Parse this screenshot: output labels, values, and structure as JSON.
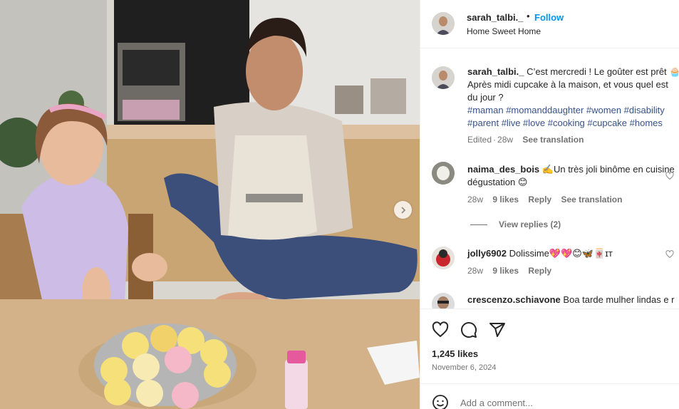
{
  "post": {
    "username": "sarah_talbi._",
    "separator": "•",
    "follow_label": "Follow",
    "location": "Home Sweet Home"
  },
  "caption": {
    "username": "sarah_talbi._",
    "line1": "C’est mercredi ! Le goûter est prêt 🧁",
    "line2": "Après midi cupcake à la maison, et vous quel est",
    "line3": "du jour ?",
    "tags_line1": "#maman #momanddaughter #women #disability",
    "tags_line2": "#parent #live #love #cooking #cupcake #homes",
    "edited": "Edited",
    "age": "28w",
    "see_translation": "See translation"
  },
  "comments": [
    {
      "username": "naima_des_bois",
      "text_line1": "✍️Un très joli binôme en cuisine",
      "text_line2": "dégustation 😊",
      "age": "28w",
      "likes": "9 likes",
      "reply": "Reply",
      "see_translation": "See translation",
      "view_replies": "View replies (2)"
    },
    {
      "username": "jolly6902",
      "text": "Dolissime💖💖😊🦋🀄ɪᴛ",
      "age": "28w",
      "likes": "9 likes",
      "reply": "Reply"
    },
    {
      "username": "crescenzo.schiavone",
      "text": "Boa tarde mulher lindas e r"
    }
  ],
  "footer": {
    "likes": "1,245 likes",
    "date": "November 6, 2024",
    "add_comment_placeholder": "Add a comment..."
  },
  "icons": {
    "like": "heart-icon",
    "comment": "comment-icon",
    "share": "share-icon",
    "emoji": "emoji-icon",
    "next": "chevron-right-icon"
  },
  "colors": {
    "follow": "#0095f6",
    "hashtag": "#385185",
    "muted": "#737373"
  }
}
